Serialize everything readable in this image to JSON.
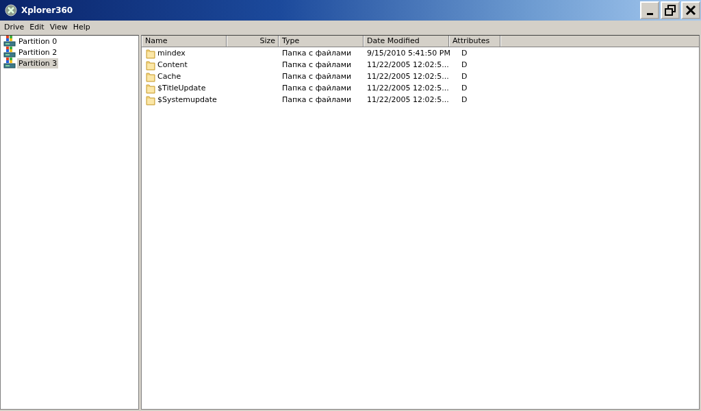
{
  "window": {
    "title": "Xplorer360"
  },
  "menu": [
    "Drive",
    "Edit",
    "View",
    "Help"
  ],
  "partitions": [
    {
      "label": "Partition 0",
      "selected": false
    },
    {
      "label": "Partition 2",
      "selected": false
    },
    {
      "label": "Partition 3",
      "selected": true
    }
  ],
  "table": {
    "columns": [
      {
        "label": "Name",
        "kind": "text"
      },
      {
        "label": "Size",
        "kind": "number"
      },
      {
        "label": "Type",
        "kind": "text"
      },
      {
        "label": "Date Modified",
        "kind": "text"
      },
      {
        "label": "Attributes",
        "kind": "text"
      }
    ],
    "rows": [
      [
        "mindex",
        "",
        "Папка с файлами",
        "9/15/2010 5:41:50 PM",
        "D"
      ],
      [
        "Content",
        "",
        "Папка с файлами",
        "11/22/2005 12:02:5...",
        "D"
      ],
      [
        "Cache",
        "",
        "Папка с файлами",
        "11/22/2005 12:02:5...",
        "D"
      ],
      [
        "$TitleUpdate",
        "",
        "Папка с файлами",
        "11/22/2005 12:02:5...",
        "D"
      ],
      [
        "$Systemupdate",
        "",
        "Папка с файлами",
        "11/22/2005 12:02:5...",
        "D"
      ]
    ]
  }
}
